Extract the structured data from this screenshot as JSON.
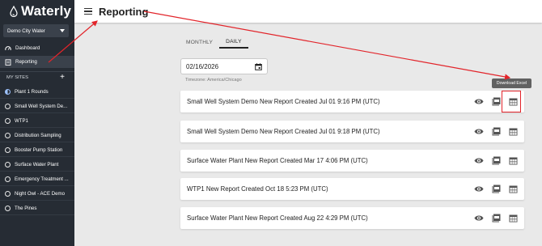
{
  "brand": {
    "name": "Waterly"
  },
  "org": {
    "selected": "Demo City Water"
  },
  "nav": [
    {
      "label": "Dashboard",
      "icon": "dashboard-icon"
    },
    {
      "label": "Reporting",
      "icon": "report-icon"
    }
  ],
  "sites": {
    "header": "MY SITES",
    "items": [
      "Plant 1 Rounds",
      "Small Well System De...",
      "WTP1",
      "Distribution Sampling",
      "Booster Pump Station",
      "Surface Water Plant",
      "Emergency Treatment ...",
      "Night Owl - ACE Demo",
      "The Pines"
    ]
  },
  "header": {
    "title": "Reporting"
  },
  "tabs": [
    {
      "label": "MONTHLY",
      "active": false
    },
    {
      "label": "DAILY",
      "active": true
    }
  ],
  "date": {
    "value": "02/16/2026",
    "timezone": "Timezone: America/Chicago"
  },
  "tooltip": "Download Excel",
  "reports": [
    {
      "title": "Small Well System Demo New Report Created Jul 01 9:16 PM (UTC)"
    },
    {
      "title": "Small Well System Demo New Report Created Jul 01 9:18 PM (UTC)"
    },
    {
      "title": "Surface Water Plant New Report Created Mar 17 4:06 PM (UTC)"
    },
    {
      "title": "WTP1 New Report Created Oct 18 5:23 PM (UTC)"
    },
    {
      "title": "Surface Water Plant New Report Created Aug 22 4:29 PM (UTC)"
    }
  ],
  "colors": {
    "sidebar": "#262c34",
    "accent_red": "#e2242a",
    "tooltip": "#616161"
  }
}
